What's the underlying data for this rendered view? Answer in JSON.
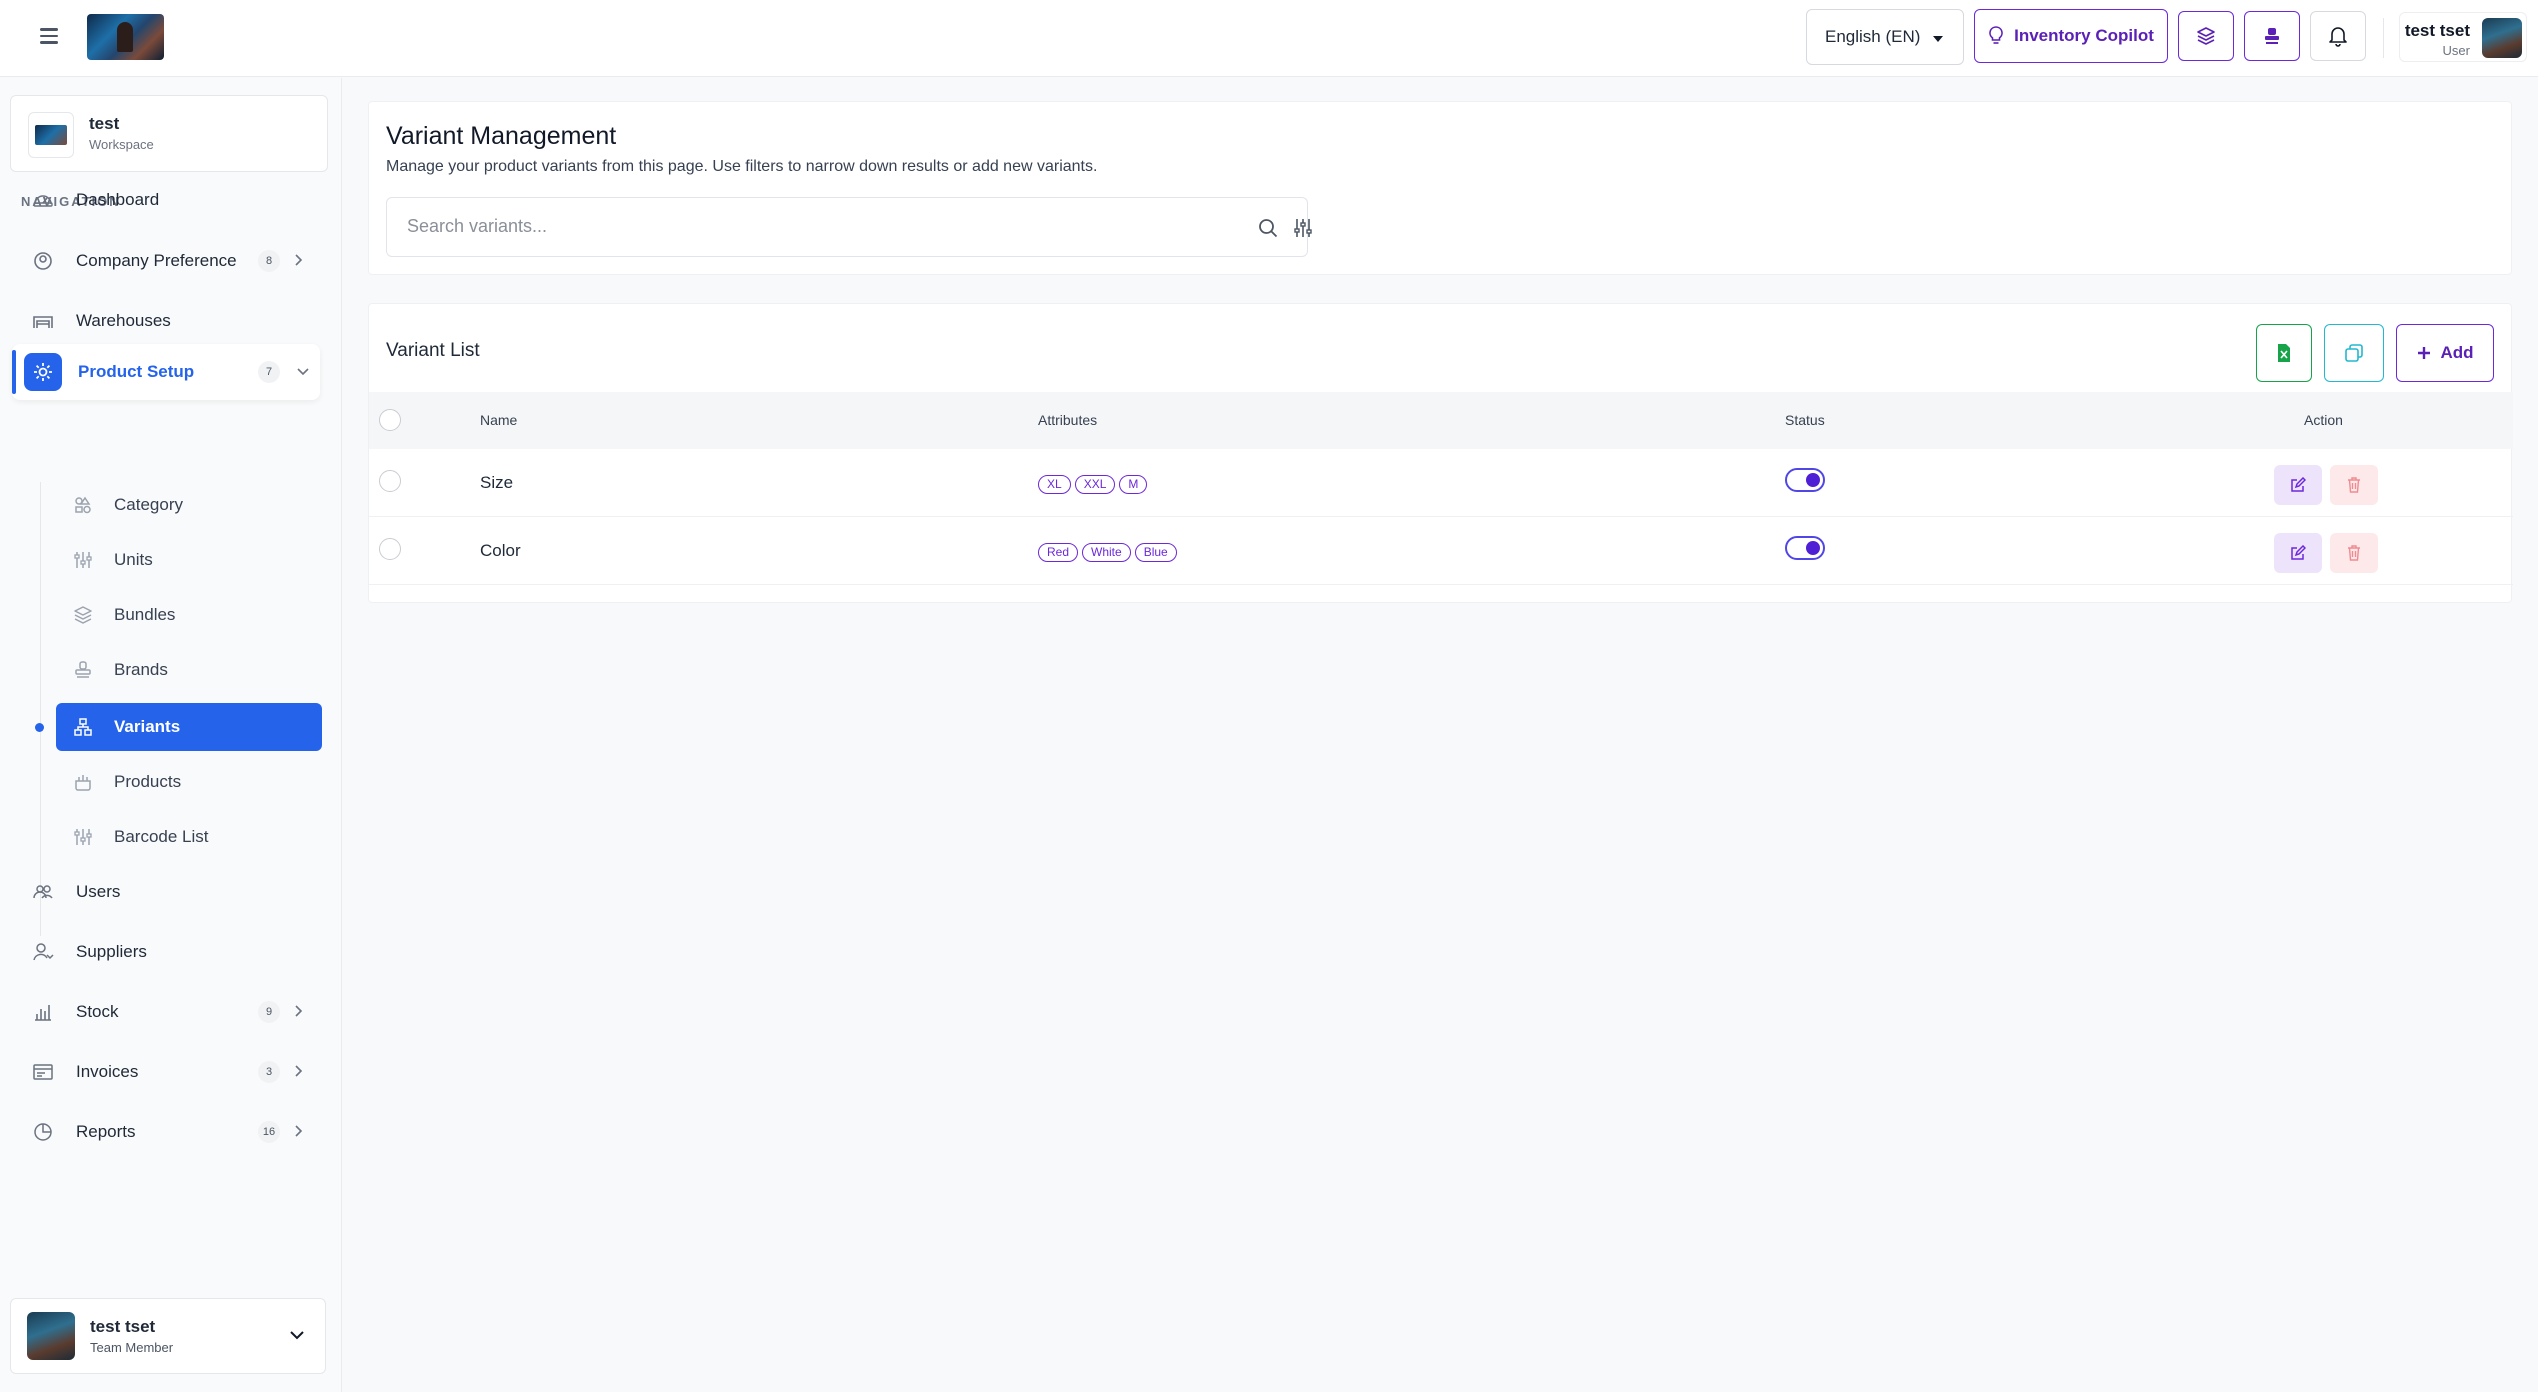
{
  "topbar": {
    "language": "English (EN)",
    "copilot_label": "Inventory Copilot",
    "user_name": "test tset",
    "user_role": "User"
  },
  "workspace": {
    "name": "test",
    "type": "Workspace"
  },
  "sidebar": {
    "heading": "NAVIGATION",
    "items": [
      {
        "label": "Dashboard",
        "icon": "dashboard-icon"
      },
      {
        "label": "Company Preference",
        "icon": "settings-user-icon",
        "count": "8"
      },
      {
        "label": "Warehouses",
        "icon": "warehouse-icon"
      },
      {
        "label": "Product Setup",
        "icon": "gear-icon",
        "count": "7",
        "active": true
      },
      {
        "label": "Users",
        "icon": "users-icon"
      },
      {
        "label": "Suppliers",
        "icon": "supplier-icon"
      },
      {
        "label": "Stock",
        "icon": "bar-chart-icon",
        "count": "9"
      },
      {
        "label": "Invoices",
        "icon": "invoice-icon",
        "count": "3"
      },
      {
        "label": "Reports",
        "icon": "pie-chart-icon",
        "count": "16"
      }
    ],
    "sub_items": [
      {
        "label": "Category",
        "icon": "category-icon"
      },
      {
        "label": "Units",
        "icon": "sliders-icon"
      },
      {
        "label": "Bundles",
        "icon": "layers-icon"
      },
      {
        "label": "Brands",
        "icon": "stamp-icon"
      },
      {
        "label": "Variants",
        "icon": "hierarchy-icon",
        "active": true
      },
      {
        "label": "Products",
        "icon": "box-icon"
      },
      {
        "label": "Barcode List",
        "icon": "sliders-icon"
      }
    ]
  },
  "footer_user": {
    "name": "test tset",
    "role": "Team Member"
  },
  "page": {
    "title": "Variant Management",
    "subtitle": "Manage your product variants from this page. Use filters to narrow down results or add new variants.",
    "search_placeholder": "Search variants..."
  },
  "list": {
    "title": "Variant List",
    "add_label": "Add",
    "columns": [
      "Name",
      "Attributes",
      "Status",
      "Action"
    ],
    "rows": [
      {
        "name": "Size",
        "attributes": [
          "XL",
          "XXL",
          "M"
        ],
        "status": true
      },
      {
        "name": "Color",
        "attributes": [
          "Red",
          "White",
          "Blue"
        ],
        "status": true
      }
    ]
  },
  "colors": {
    "primary": "#2563eb",
    "accent_purple": "#6d28d9",
    "excel_green": "#16a34a",
    "copy_cyan": "#22b8cf"
  }
}
